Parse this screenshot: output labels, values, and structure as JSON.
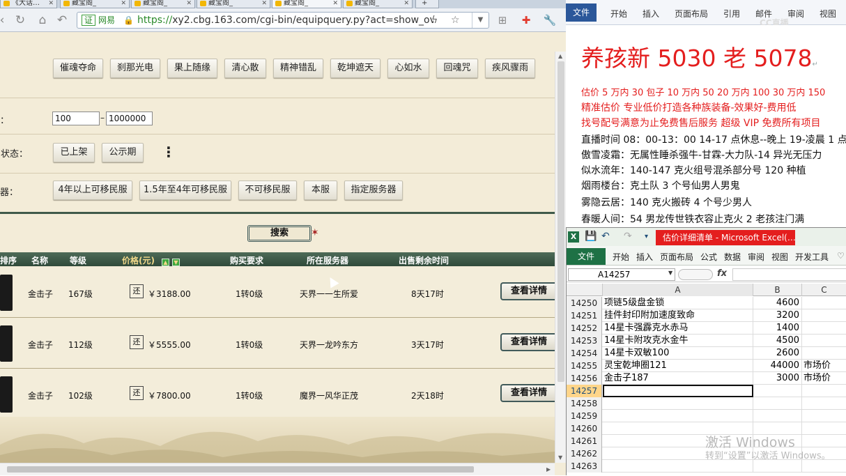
{
  "browser": {
    "tabs": [
      {
        "label": "《大话…"
      },
      {
        "label": "藏宝阁_"
      },
      {
        "label": "藏宝阁_"
      },
      {
        "label": "藏宝阁_"
      },
      {
        "label": "藏宝阁_"
      },
      {
        "label": "藏宝阁_"
      }
    ],
    "cert_label": "证",
    "cert_name": "网易",
    "url_scheme": "https://",
    "url_rest": "xy2.cbg.163.com/cgi-bin/equipquery.py?act=show_ov"
  },
  "page": {
    "skill_buttons": [
      "催魂夺命",
      "刹那光电",
      "果上随缘",
      "清心散",
      "精神错乱",
      "乾坤遮天",
      "心如水",
      "回魂咒",
      "疾风骤雨"
    ],
    "price_label": "：",
    "price_min": "100",
    "price_sep": "–",
    "price_max": "1000000",
    "status_label": "售状态：",
    "status_buttons": [
      "已上架",
      "公示期"
    ],
    "more_glyph": "⋮",
    "server_label": "器：",
    "server_buttons": [
      "4年以上可移民服",
      "1.5年至4年可移民服",
      "不可移民服",
      "本服",
      "指定服务器"
    ],
    "search_label": "搜索",
    "table_headers": {
      "order": "排序",
      "name": "名称",
      "level": "等级",
      "price": "价格(元)",
      "require": "购买要求",
      "server": "所在服务器",
      "time": "出售剩余时间"
    },
    "rows": [
      {
        "name": "金击子",
        "level": "167级",
        "bargain": "还",
        "price": "￥3188.00",
        "require": "1转0级",
        "server": "天界一一生所爱",
        "time": "8天17时",
        "detail": "查看详情"
      },
      {
        "name": "金击子",
        "level": "112级",
        "bargain": "还",
        "price": "￥5555.00",
        "require": "1转0级",
        "server": "天界一龙吟东方",
        "time": "3天17时",
        "detail": "查看详情"
      },
      {
        "name": "金击子",
        "level": "102级",
        "bargain": "还",
        "price": "￥7800.00",
        "require": "1转0级",
        "server": "魔界一风华正茂",
        "time": "2天18时",
        "detail": "查看详情"
      }
    ]
  },
  "word": {
    "file_tab": "文件",
    "tabs": [
      "开始",
      "插入",
      "页面布局",
      "引用",
      "邮件",
      "审阅",
      "视图"
    ],
    "watermark": "CC直播",
    "headline": "养孩新 5030 老 5078",
    "lines_red": [
      "估价 5 万内 30 包子   10 万内 50  20 万内 100  30 万内 150",
      "精准估价  专业低价打造各种族装备-效果好-费用低",
      "找号配号满意为止免费售后服务   超级 VIP 免费所有项目"
    ],
    "lines_black": [
      "直播时间 08：00-13：00 14-17 点休息--晚上 19-凌晨 1 点",
      "傲雪凌霜：无属性睡杀强牛-甘霖-大力队-14 异光无压力",
      "似水流年：140-147 克火组号混杀部分号 120 种植",
      "烟雨楼台：克土队 3 个号仙男人男鬼",
      "雾隐云居：140 克火搬砖 4 个号少男人",
      "春暖人间：54 男龙传世铁衣容止克火 2 老孩注门满"
    ]
  },
  "excel": {
    "title": "估价详细清单 - Microsoft Excel(…",
    "file_tab": "文件",
    "tabs": [
      "开始",
      "插入",
      "页面布局",
      "公式",
      "数据",
      "审阅",
      "视图",
      "开发工具"
    ],
    "name_box": "A14257",
    "fx": "fx",
    "columns": [
      "A",
      "B",
      "C"
    ],
    "rows": [
      {
        "n": "14250",
        "a": "项链5级盘金锁",
        "b": "4600",
        "c": ""
      },
      {
        "n": "14251",
        "a": "挂件封印附加速度致命",
        "b": "3200",
        "c": ""
      },
      {
        "n": "14252",
        "a": "14星卡强霹克水赤马",
        "b": "1400",
        "c": ""
      },
      {
        "n": "14253",
        "a": "14星卡附攻克水金牛",
        "b": "4500",
        "c": ""
      },
      {
        "n": "14254",
        "a": "14星卡双敏100",
        "b": "2600",
        "c": ""
      },
      {
        "n": "14255",
        "a": "灵宝乾坤圈121",
        "b": "44000",
        "c": "市场价"
      },
      {
        "n": "14256",
        "a": "金击子187",
        "b": "3000",
        "c": "市场价"
      },
      {
        "n": "14257",
        "a": "",
        "b": "",
        "c": ""
      },
      {
        "n": "14258",
        "a": "",
        "b": "",
        "c": ""
      },
      {
        "n": "14259",
        "a": "",
        "b": "",
        "c": ""
      },
      {
        "n": "14260",
        "a": "",
        "b": "",
        "c": ""
      },
      {
        "n": "14261",
        "a": "",
        "b": "",
        "c": ""
      },
      {
        "n": "14262",
        "a": "",
        "b": "",
        "c": ""
      },
      {
        "n": "14263",
        "a": "",
        "b": "",
        "c": ""
      }
    ]
  },
  "windows": {
    "wm_line1": "激活 Windows",
    "wm_line2": "转到“设置”以激活 Windows。"
  }
}
